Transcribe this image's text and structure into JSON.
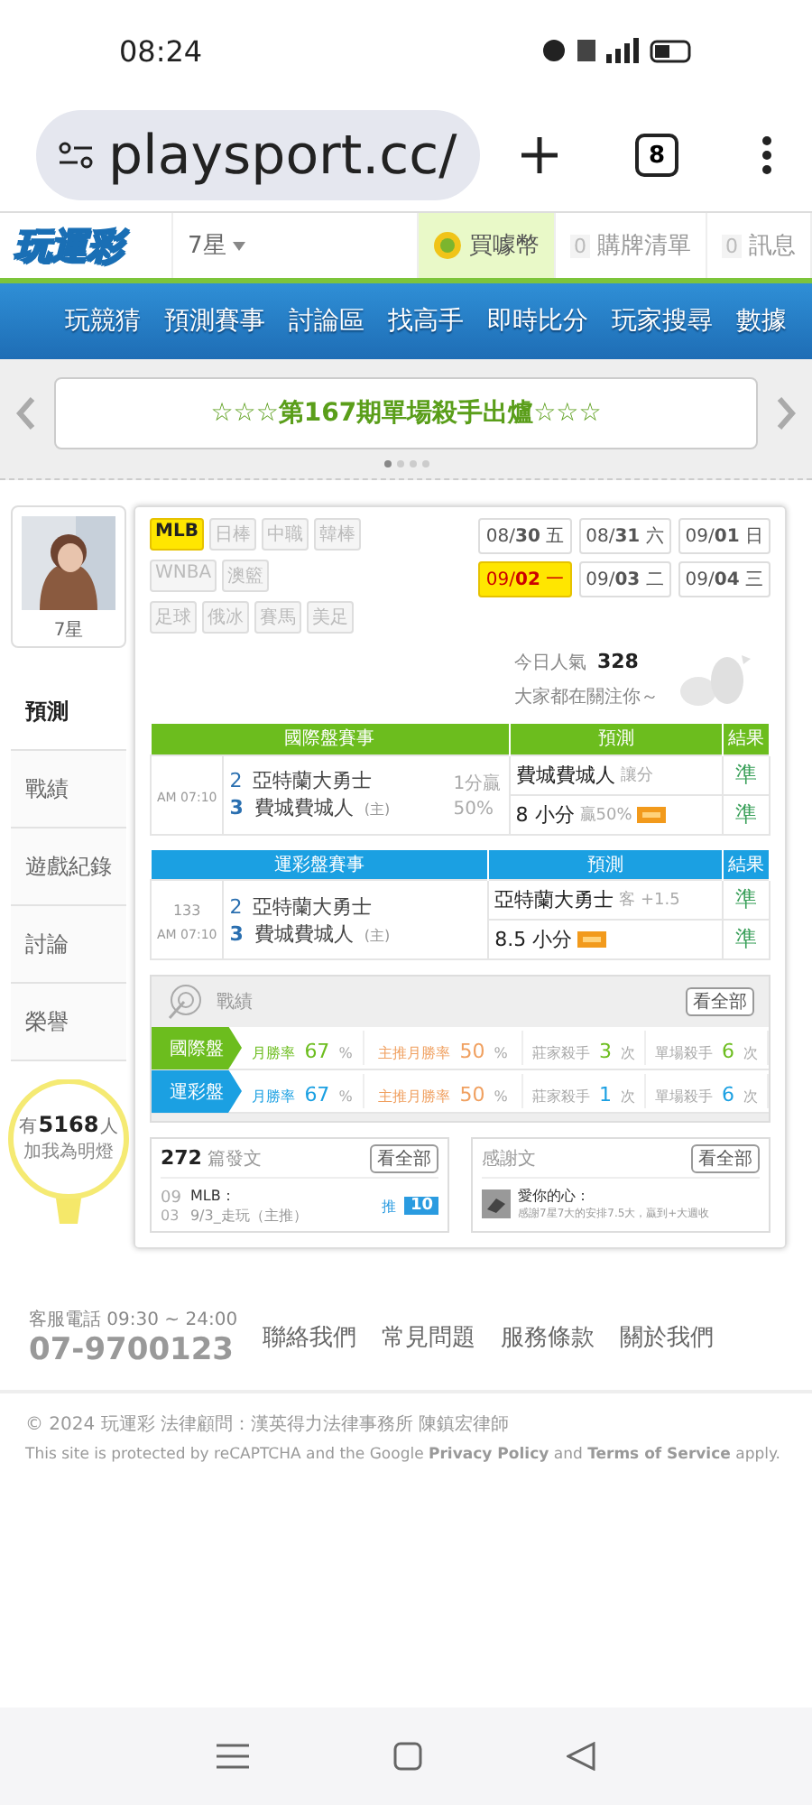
{
  "status_bar": {
    "time": "08:24"
  },
  "browser": {
    "url": "playsport.cc/",
    "tab_count": "8"
  },
  "header": {
    "logo": "玩運彩",
    "level": "7星",
    "coin": "買噱幣",
    "cart": {
      "count": "0",
      "label": "購牌清單"
    },
    "messages": {
      "count": "0",
      "label": "訊息"
    }
  },
  "nav": [
    "玩競猜",
    "預測賽事",
    "討論區",
    "找高手",
    "即時比分",
    "玩家搜尋",
    "數據"
  ],
  "banner": {
    "text": "☆☆☆第167期單場殺手出爐☆☆☆"
  },
  "profile": {
    "name": "7星"
  },
  "sidebar": [
    {
      "label": "預測",
      "selected": true
    },
    {
      "label": "戰績",
      "selected": false
    },
    {
      "label": "遊戲紀錄",
      "selected": false
    },
    {
      "label": "討論",
      "selected": false
    },
    {
      "label": "榮譽",
      "selected": false
    }
  ],
  "fans": {
    "prefix": "有",
    "count": "5168",
    "suffix": "人",
    "caption": "加我為明燈"
  },
  "league_rows": [
    {
      "items": [
        {
          "label": "MLB",
          "selected": true
        },
        {
          "label": "日棒",
          "selected": false
        },
        {
          "label": "中職",
          "selected": false
        },
        {
          "label": "韓棒",
          "selected": false
        }
      ]
    },
    {
      "items": [
        {
          "label": "WNBA",
          "selected": false
        },
        {
          "label": "澳籃",
          "selected": false
        }
      ]
    },
    {
      "items": [
        {
          "label": "足球",
          "selected": false
        },
        {
          "label": "俄冰",
          "selected": false
        },
        {
          "label": "賽馬",
          "selected": false
        },
        {
          "label": "美足",
          "selected": false
        }
      ]
    }
  ],
  "dates": [
    {
      "month": "08/",
      "day": "30",
      "weekday": "五",
      "selected": false
    },
    {
      "month": "08/",
      "day": "31",
      "weekday": "六",
      "selected": false
    },
    {
      "month": "09/",
      "day": "01",
      "weekday": "日",
      "selected": false
    },
    {
      "month": "09/",
      "day": "02",
      "weekday": "一",
      "selected": true
    },
    {
      "month": "09/",
      "day": "03",
      "weekday": "二",
      "selected": false
    },
    {
      "month": "09/",
      "day": "04",
      "weekday": "三",
      "selected": false
    }
  ],
  "popularity": {
    "label": "今日人氣",
    "count": "328",
    "caption": "大家都在關注你～"
  },
  "tables": [
    {
      "kind": "intl",
      "columns": [
        "國際盤賽事",
        "預測",
        "結果"
      ],
      "time": "AM 07:10",
      "teams": [
        {
          "score": "2",
          "name": "亞特蘭大勇士"
        },
        {
          "score": "3",
          "name": "費城費城人",
          "mark": "(主)"
        }
      ],
      "extra": [
        "1分贏",
        "50%"
      ],
      "predictions": [
        {
          "text": "費城費城人",
          "note": "讓分",
          "badge": false,
          "result": "準"
        },
        {
          "text": "8 小分",
          "note": "贏50%",
          "badge": true,
          "result": "準"
        }
      ]
    },
    {
      "kind": "lottery",
      "columns": [
        "運彩盤賽事",
        "預測",
        "結果"
      ],
      "game_no": "133",
      "time": "AM 07:10",
      "teams": [
        {
          "score": "2",
          "name": "亞特蘭大勇士"
        },
        {
          "score": "3",
          "name": "費城費城人",
          "mark": "(主)"
        }
      ],
      "predictions": [
        {
          "text": "亞特蘭大勇士",
          "note": "客 +1.5",
          "badge": false,
          "result": "準"
        },
        {
          "text": "8.5 小分",
          "badge": true,
          "result": "準"
        }
      ]
    }
  ],
  "record": {
    "title": "戰績",
    "button": "看全部",
    "rows": [
      {
        "kind": "intl",
        "label": "國際盤",
        "cells": [
          {
            "label": "月勝率",
            "value": "67",
            "unit": "%"
          },
          {
            "label": "主推月勝率",
            "value": "50",
            "unit": "%"
          },
          {
            "label": "莊家殺手",
            "value": "3",
            "unit": "次"
          },
          {
            "label": "單場殺手",
            "value": "6",
            "unit": "次"
          }
        ]
      },
      {
        "kind": "lottery",
        "label": "運彩盤",
        "cells": [
          {
            "label": "月勝率",
            "value": "67",
            "unit": "%"
          },
          {
            "label": "主推月勝率",
            "value": "50",
            "unit": "%"
          },
          {
            "label": "莊家殺手",
            "value": "1",
            "unit": "次"
          },
          {
            "label": "單場殺手",
            "value": "6",
            "unit": "次"
          }
        ]
      }
    ]
  },
  "posts": {
    "count": "272",
    "label": "篇發文",
    "button": "看全部",
    "item": {
      "month": "09",
      "day": "03",
      "title": "MLB：",
      "text": "9/3_走玩（主推）",
      "push_label": "推",
      "push_count": "10"
    }
  },
  "thanks": {
    "title": "感謝文",
    "button": "看全部",
    "item": {
      "title": "愛你的心：",
      "text": "感謝7星7大的安排7.5大，贏到+大週收"
    }
  },
  "footer": {
    "phone_label": "客服電話 09:30 ~ 24:00",
    "phone": "07-9700123",
    "links": [
      "聯絡我們",
      "常見問題",
      "服務條款",
      "關於我們"
    ],
    "copyright": "© 2024 玩運彩 法律顧問：漢英得力法律事務所 陳鎮宏律師",
    "recaptcha": "This site is protected by reCAPTCHA and the Google **Privacy Policy** and **Terms of Service** apply."
  }
}
